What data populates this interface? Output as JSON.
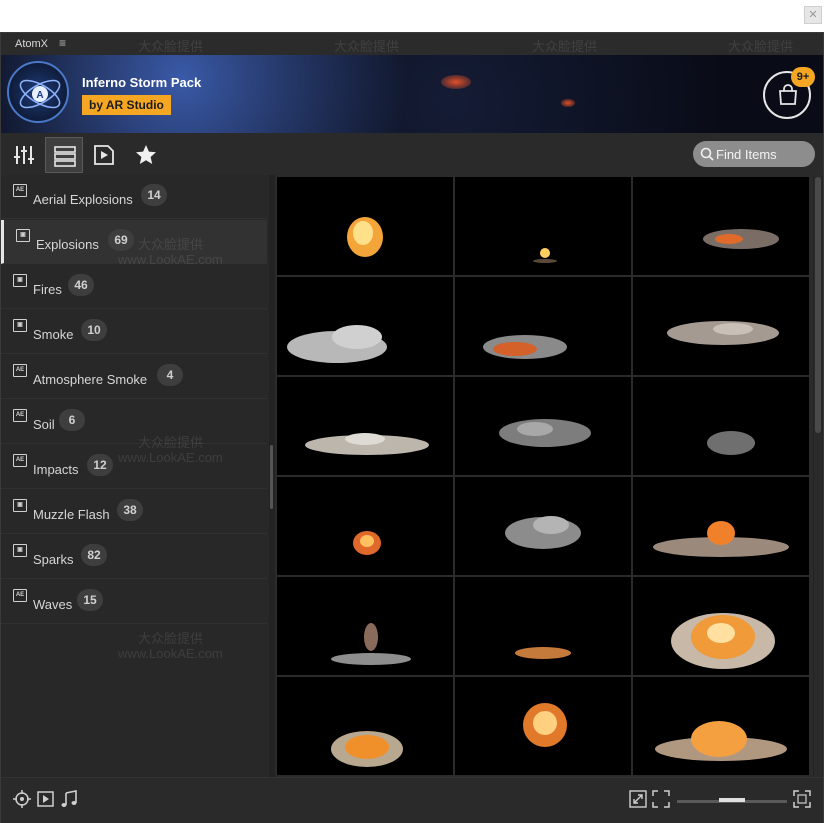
{
  "window": {
    "tab_title": "AtomX"
  },
  "banner": {
    "pack_title": "Inferno Storm Pack",
    "author": "by AR Studio",
    "cart_badge": "9+"
  },
  "toolbar": {
    "search_placeholder": "Find Items"
  },
  "categories": [
    {
      "label": "Aerial Explosions",
      "count": "14"
    },
    {
      "label": "Explosions",
      "count": "69"
    },
    {
      "label": "Fires",
      "count": "46"
    },
    {
      "label": "Smoke",
      "count": "10"
    },
    {
      "label": "Atmosphere Smoke",
      "count": "4"
    },
    {
      "label": "Soil",
      "count": "6"
    },
    {
      "label": "Impacts",
      "count": "12"
    },
    {
      "label": "Muzzle Flash",
      "count": "38"
    },
    {
      "label": "Sparks",
      "count": "82"
    },
    {
      "label": "Waves",
      "count": "15"
    }
  ],
  "category_icon_text": "AE",
  "colors": {
    "accent": "#f5a623",
    "panel": "#232323",
    "sidebar": "#282828"
  },
  "watermark": {
    "line1": "大众脸提供",
    "line2": "www.LookAE.com"
  }
}
